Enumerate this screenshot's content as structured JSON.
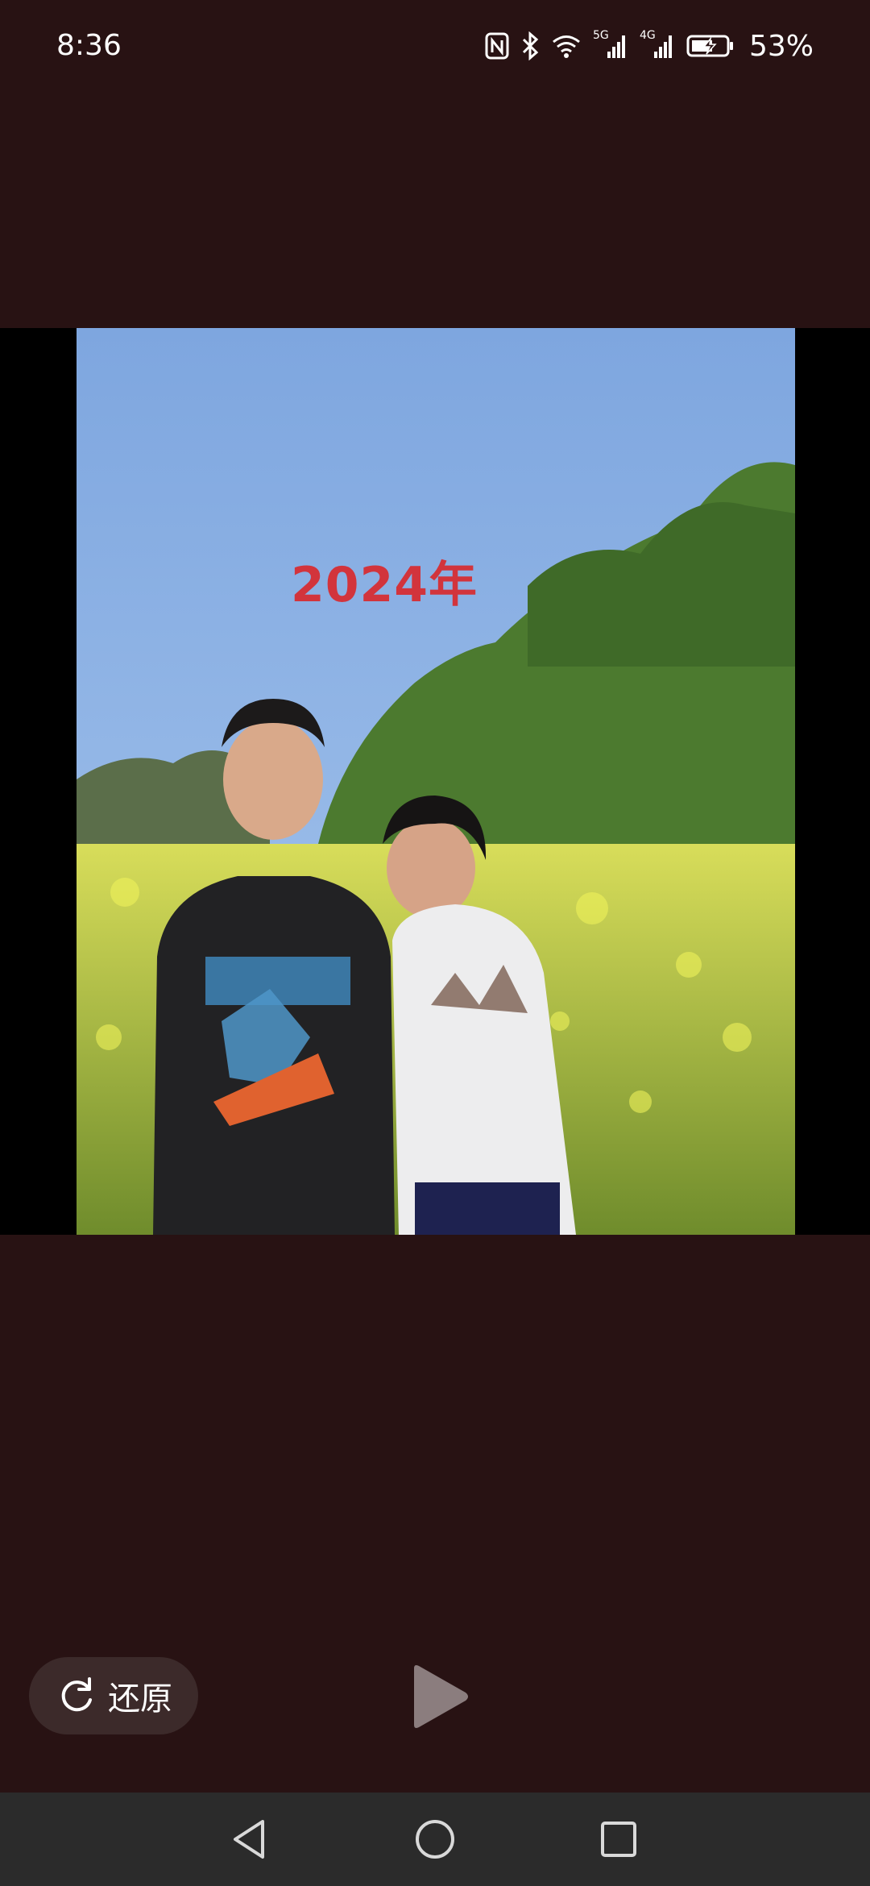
{
  "status_bar": {
    "time": "8:36",
    "battery_percent": "53%",
    "network_5g": "5G",
    "network_4g": "4G",
    "icons": [
      "nfc-icon",
      "bluetooth-icon",
      "wifi-icon",
      "signal-5g-icon",
      "signal-4g-icon",
      "battery-charging-icon"
    ]
  },
  "media": {
    "overlay_text": "2024年"
  },
  "controls": {
    "restore_label": "还原",
    "restore_icon": "rotate-icon",
    "play_icon": "play-icon"
  },
  "nav_bar": {
    "items": [
      "back-icon",
      "home-icon",
      "recents-icon"
    ]
  },
  "colors": {
    "background": "#281213",
    "overlay_text": "#d2343c",
    "nav_bar": "#2b2b2b"
  }
}
